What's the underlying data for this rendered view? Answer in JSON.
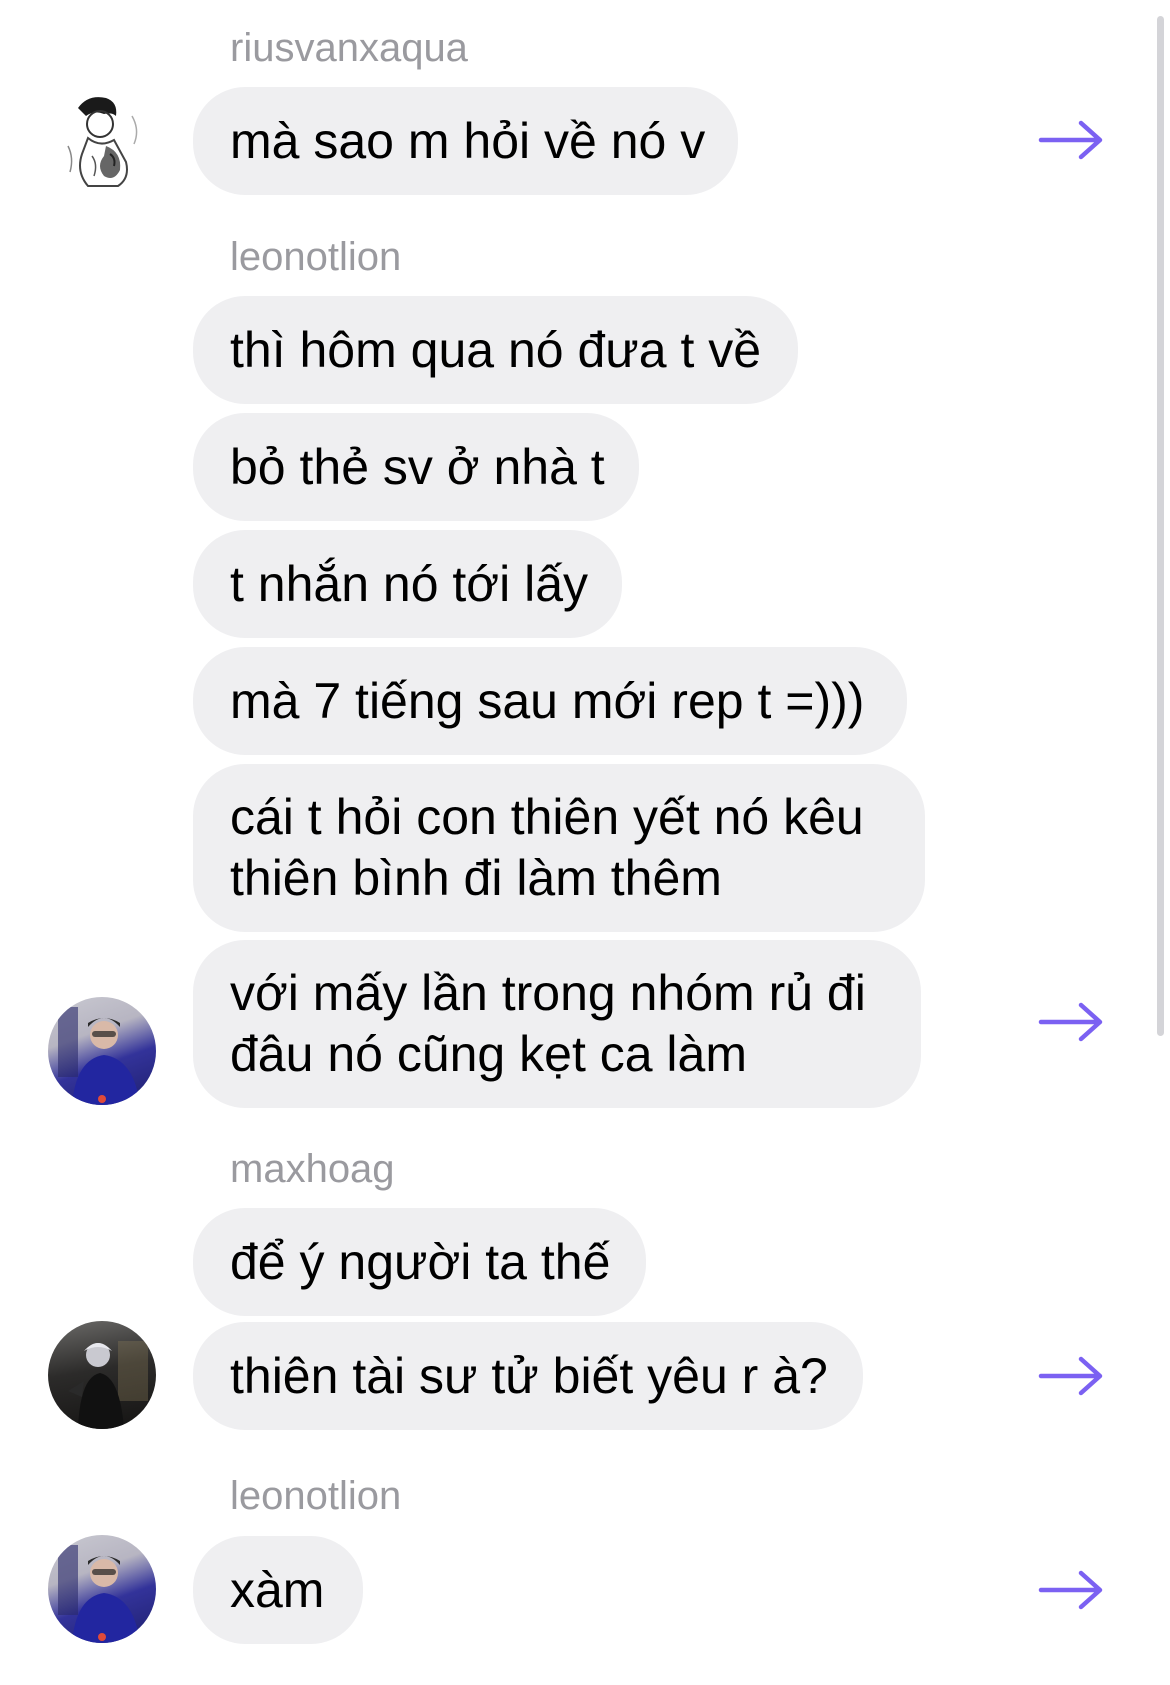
{
  "accent_color": "#7b61f2",
  "bubble_color": "#efeff1",
  "sender_color": "#9a9a9f",
  "messages": [
    {
      "sender": "riusvanxaqua"
    },
    {
      "text": "mà sao m hỏi về nó v"
    },
    {
      "sender": "leonotlion"
    },
    {
      "text": "thì hôm qua nó đưa t về"
    },
    {
      "text": "bỏ thẻ sv ở nhà t"
    },
    {
      "text": "t nhắn nó tới lấy"
    },
    {
      "text": "mà 7 tiếng sau mới rep t =)))"
    },
    {
      "text": "cái t hỏi con thiên yết nó kêu thiên bình đi làm thêm"
    },
    {
      "text": "với mấy lần trong nhóm rủ đi đâu nó cũng kẹt ca làm"
    },
    {
      "sender": "maxhoag"
    },
    {
      "text": "để ý người ta thế"
    },
    {
      "text": "thiên tài sư tử biết yêu r à?"
    },
    {
      "sender": "leonotlion"
    },
    {
      "text": "xàm"
    }
  ],
  "icons": {
    "forward": "forward-arrow-icon",
    "avatar": "user-avatar"
  }
}
